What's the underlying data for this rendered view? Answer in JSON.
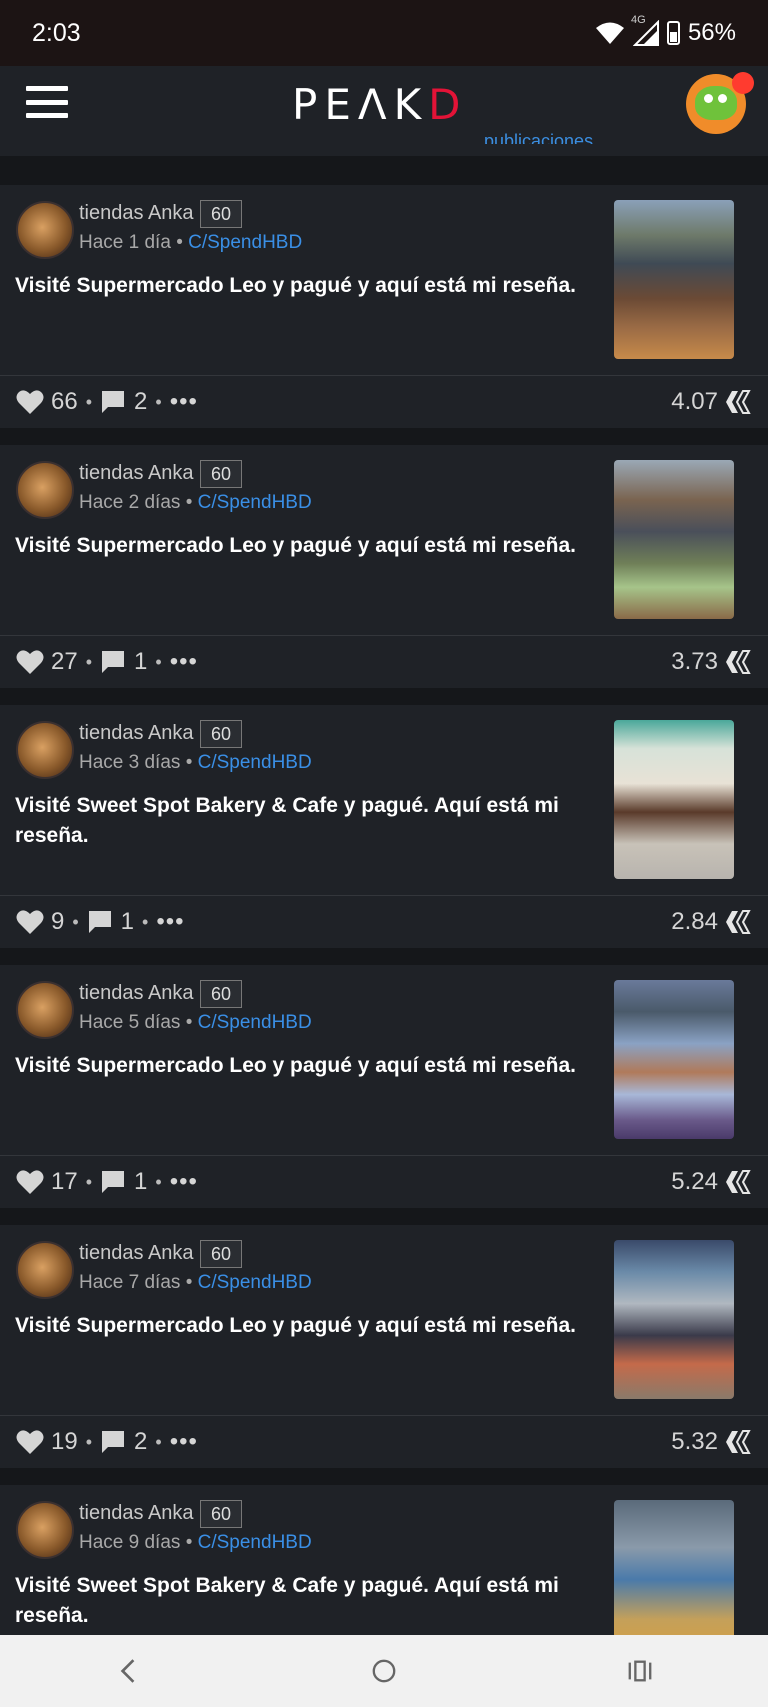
{
  "status_bar": {
    "time": "2:03",
    "network": "4G",
    "battery": "56%"
  },
  "header": {
    "logo_left": "PE",
    "logo_a": "Λ",
    "logo_k": "K",
    "logo_d": "D",
    "hidden_link": "publicaciones"
  },
  "posts": [
    {
      "author": "tiendas Anka",
      "rep": "60",
      "time": "Hace 1 día",
      "community": "C/SpendHBD",
      "title": "Visité Supermercado Leo y pagué y aquí está mi reseña.",
      "likes": "66",
      "comments": "2",
      "payout": "4.07"
    },
    {
      "author": "tiendas Anka",
      "rep": "60",
      "time": "Hace 2 días",
      "community": "C/SpendHBD",
      "title": "Visité Supermercado Leo y pagué y aquí está mi reseña.",
      "likes": "27",
      "comments": "1",
      "payout": "3.73"
    },
    {
      "author": "tiendas Anka",
      "rep": "60",
      "time": "Hace 3 días",
      "community": "C/SpendHBD",
      "title": "Visité Sweet Spot Bakery & Cafe y pagué. Aquí está mi reseña.",
      "likes": "9",
      "comments": "1",
      "payout": "2.84"
    },
    {
      "author": "tiendas Anka",
      "rep": "60",
      "time": "Hace 5 días",
      "community": "C/SpendHBD",
      "title": "Visité Supermercado Leo y pagué y aquí está mi reseña.",
      "likes": "17",
      "comments": "1",
      "payout": "5.24"
    },
    {
      "author": "tiendas Anka",
      "rep": "60",
      "time": "Hace 7 días",
      "community": "C/SpendHBD",
      "title": "Visité Supermercado Leo y pagué y aquí está mi reseña.",
      "likes": "19",
      "comments": "2",
      "payout": "5.32"
    },
    {
      "author": "tiendas Anka",
      "rep": "60",
      "time": "Hace 9 días",
      "community": "C/SpendHBD",
      "title": "Visité Sweet Spot Bakery & Cafe y pagué. Aquí está mi reseña."
    }
  ],
  "common": {
    "separator": "•",
    "more": "•••"
  },
  "colors": {
    "accent": "#3a8fe6",
    "brand_red": "#e31337",
    "card_bg": "#1f2227"
  },
  "icons": {
    "menu": "hamburger-menu-icon",
    "like": "heart-icon",
    "comment": "comment-bubble-icon",
    "currency": "hive-icon",
    "nav_back": "back-icon",
    "nav_home": "home-icon",
    "nav_recents": "recents-icon"
  }
}
